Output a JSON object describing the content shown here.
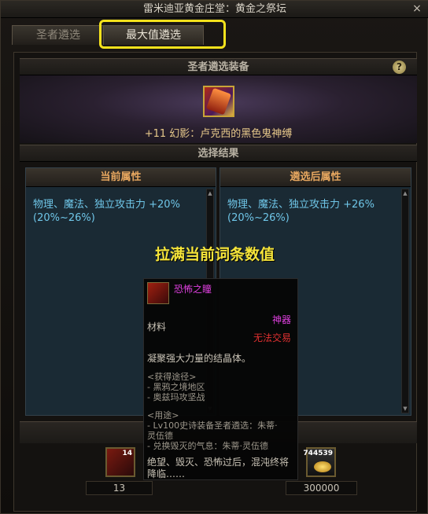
{
  "window": {
    "title": "雷米迪亚黄金庄堂：黄金之祭坛",
    "close": "×"
  },
  "tabs": [
    {
      "label": "圣者遴选"
    },
    {
      "label": "最大值遴选"
    }
  ],
  "equip_section": {
    "title": "圣者遴选装备",
    "help": "?",
    "item_name": "+11 幻影：卢克西的黑色鬼神缚"
  },
  "result_section": {
    "title": "选择结果"
  },
  "current": {
    "header": "当前属性",
    "text": "物理、魔法、独立攻击力 +20% (20%~26%)"
  },
  "after": {
    "header": "遴选后属性",
    "text": "物理、魔法、独立攻击力 +26% (20%~26%)"
  },
  "overlay_caption": "拉满当前词条数值",
  "tooltip": {
    "name": "恐怖之瞳",
    "rarity": "神器",
    "type": "材料",
    "trade": "无法交易",
    "desc": "凝聚强大力量的结晶体。",
    "obtain_title": "<获得途径>",
    "obtain_1": "- 黑鸦之境地区",
    "obtain_2": "- 奥兹玛攻坚战",
    "use_title": "<用途>",
    "use_1": "- Lv100史诗装备圣者遴选：朱蒂·",
    "use_1b": "灵伍德",
    "use_2": "- 兑换毁灭的气息：朱蒂·灵伍德",
    "footer": "绝望、毁灭、恐怖过后，混沌终将降临……"
  },
  "slots": {
    "material_count": "14",
    "gold_count": "744539",
    "material_value": "13",
    "gold_value": "300000"
  },
  "colors": {
    "highlight": "#f5e21c",
    "attr_text": "#6fc6e8",
    "rarity": "#e040e0"
  }
}
